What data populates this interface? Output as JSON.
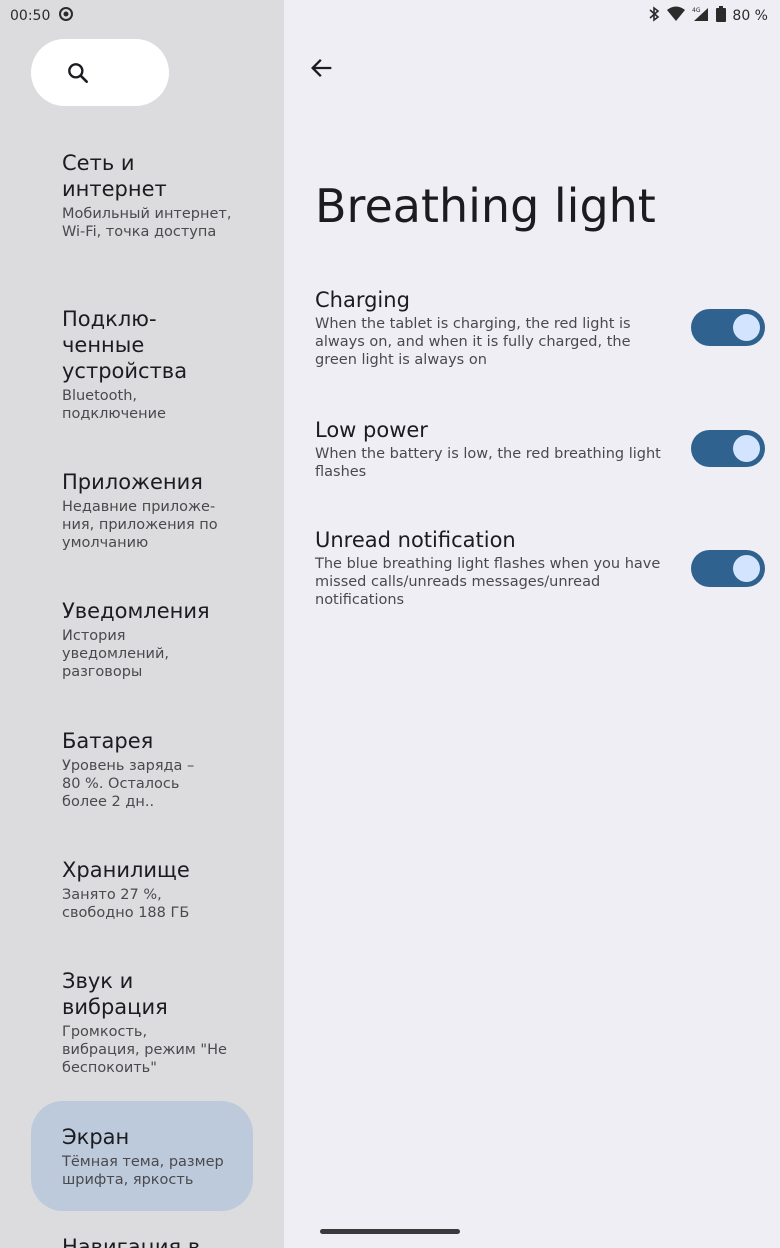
{
  "status": {
    "time": "00:50",
    "battery": "80 %"
  },
  "sidebar": {
    "items": [
      {
        "title": "Сеть и\nинтернет",
        "subtitle": "Мобильный интернет, Wi-Fi, точка доступа"
      },
      {
        "title": "Подклю-\nченные\nустройства",
        "subtitle": "Bluetooth, подключение"
      },
      {
        "title": "Приложения",
        "subtitle": "Недавние приложе-\nния, приложения по умолчанию"
      },
      {
        "title": "Уведомления",
        "subtitle": "История уведомлений, разговоры"
      },
      {
        "title": "Батарея",
        "subtitle": "Уровень заряда –\n80 %. Осталось\nболее 2 дн.."
      },
      {
        "title": "Хранилище",
        "subtitle": "Занято 27 %,\nсвободно 188 ГБ"
      },
      {
        "title": "Звук и\nвибрация",
        "subtitle": "Громкость,\nвибрация, режим \"Не беспокоить\""
      },
      {
        "title": "Экран",
        "subtitle": "Тёмная тема, размер шрифта, яркость"
      },
      {
        "title": "Навигация в",
        "subtitle": ""
      }
    ]
  },
  "main": {
    "title": "Breathing light",
    "settings": [
      {
        "title": "Charging",
        "description": "When the tablet is charging, the red light is always on, and when it is fully charged, the green light is always on",
        "enabled": true
      },
      {
        "title": "Low power",
        "description": "When the battery is low, the red breathing light flashes",
        "enabled": true
      },
      {
        "title": "Unread notification",
        "description": "The blue breathing light flashes when you have missed calls/unreads messages/unread notifications",
        "enabled": true
      }
    ]
  },
  "colors": {
    "toggle_track": "#2f628f",
    "toggle_knob": "#d3e4ff",
    "active_item": "#bccadb"
  }
}
